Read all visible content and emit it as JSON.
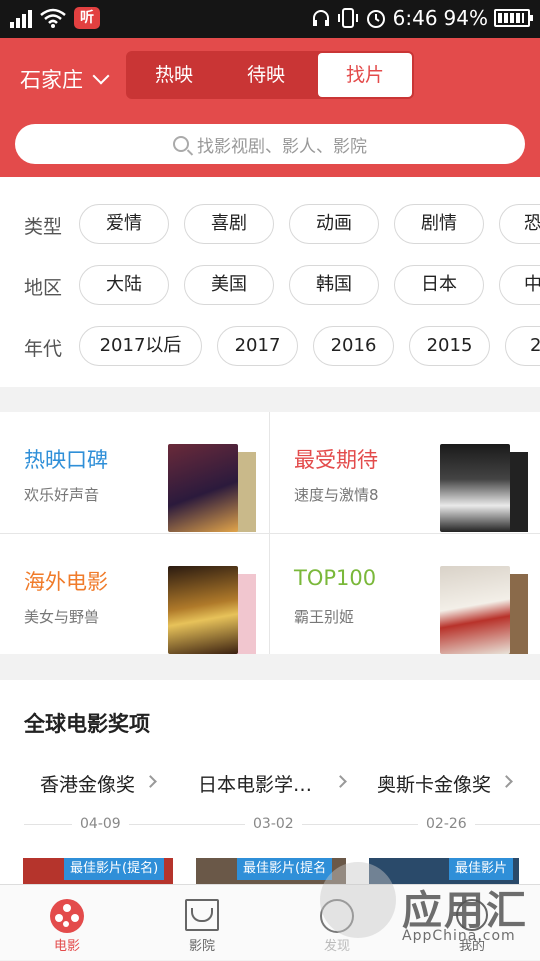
{
  "status_bar": {
    "time": "6:46",
    "battery": "94%",
    "listen_badge": "听"
  },
  "header": {
    "city": "石家庄",
    "tabs": [
      {
        "label": "热映",
        "active": false
      },
      {
        "label": "待映",
        "active": false
      },
      {
        "label": "找片",
        "active": true
      }
    ],
    "search_placeholder": "找影视剧、影人、影院"
  },
  "filters": {
    "type": {
      "label": "类型",
      "options": [
        "爱情",
        "喜剧",
        "动画",
        "剧情",
        "恐"
      ]
    },
    "region": {
      "label": "地区",
      "options": [
        "大陆",
        "美国",
        "韩国",
        "日本",
        "中"
      ]
    },
    "era": {
      "label": "年代",
      "options": [
        "2017以后",
        "2017",
        "2016",
        "2015",
        "20"
      ]
    }
  },
  "lists": [
    {
      "title": "热映口碑",
      "subtitle": "欢乐好声音",
      "color": "#2f8fd8"
    },
    {
      "title": "最受期待",
      "subtitle": "速度与激情8",
      "color": "#e34b4b"
    },
    {
      "title": "海外电影",
      "subtitle": "美女与野兽",
      "color": "#f07b2a"
    },
    {
      "title": "TOP100",
      "subtitle": "霸王别姬",
      "color": "#7ab83a"
    }
  ],
  "awards": {
    "title": "全球电影奖项",
    "items": [
      {
        "name": "香港金像奖",
        "date": "04-09",
        "tag": "最佳影片(提名)"
      },
      {
        "name": "日本电影学…",
        "date": "03-02",
        "tag": "最佳影片(提名"
      },
      {
        "name": "奥斯卡金像奖",
        "date": "02-26",
        "tag": "最佳影片"
      }
    ]
  },
  "tabbar": [
    {
      "label": "电影",
      "icon": "film-reel-icon",
      "active": true
    },
    {
      "label": "影院",
      "icon": "cinema-icon",
      "active": false
    },
    {
      "label": "发现",
      "icon": "discover-icon",
      "active": false
    },
    {
      "label": "我的",
      "icon": "profile-icon",
      "active": false
    }
  ],
  "watermark": {
    "text": "应用汇",
    "url": "AppChina.com"
  }
}
